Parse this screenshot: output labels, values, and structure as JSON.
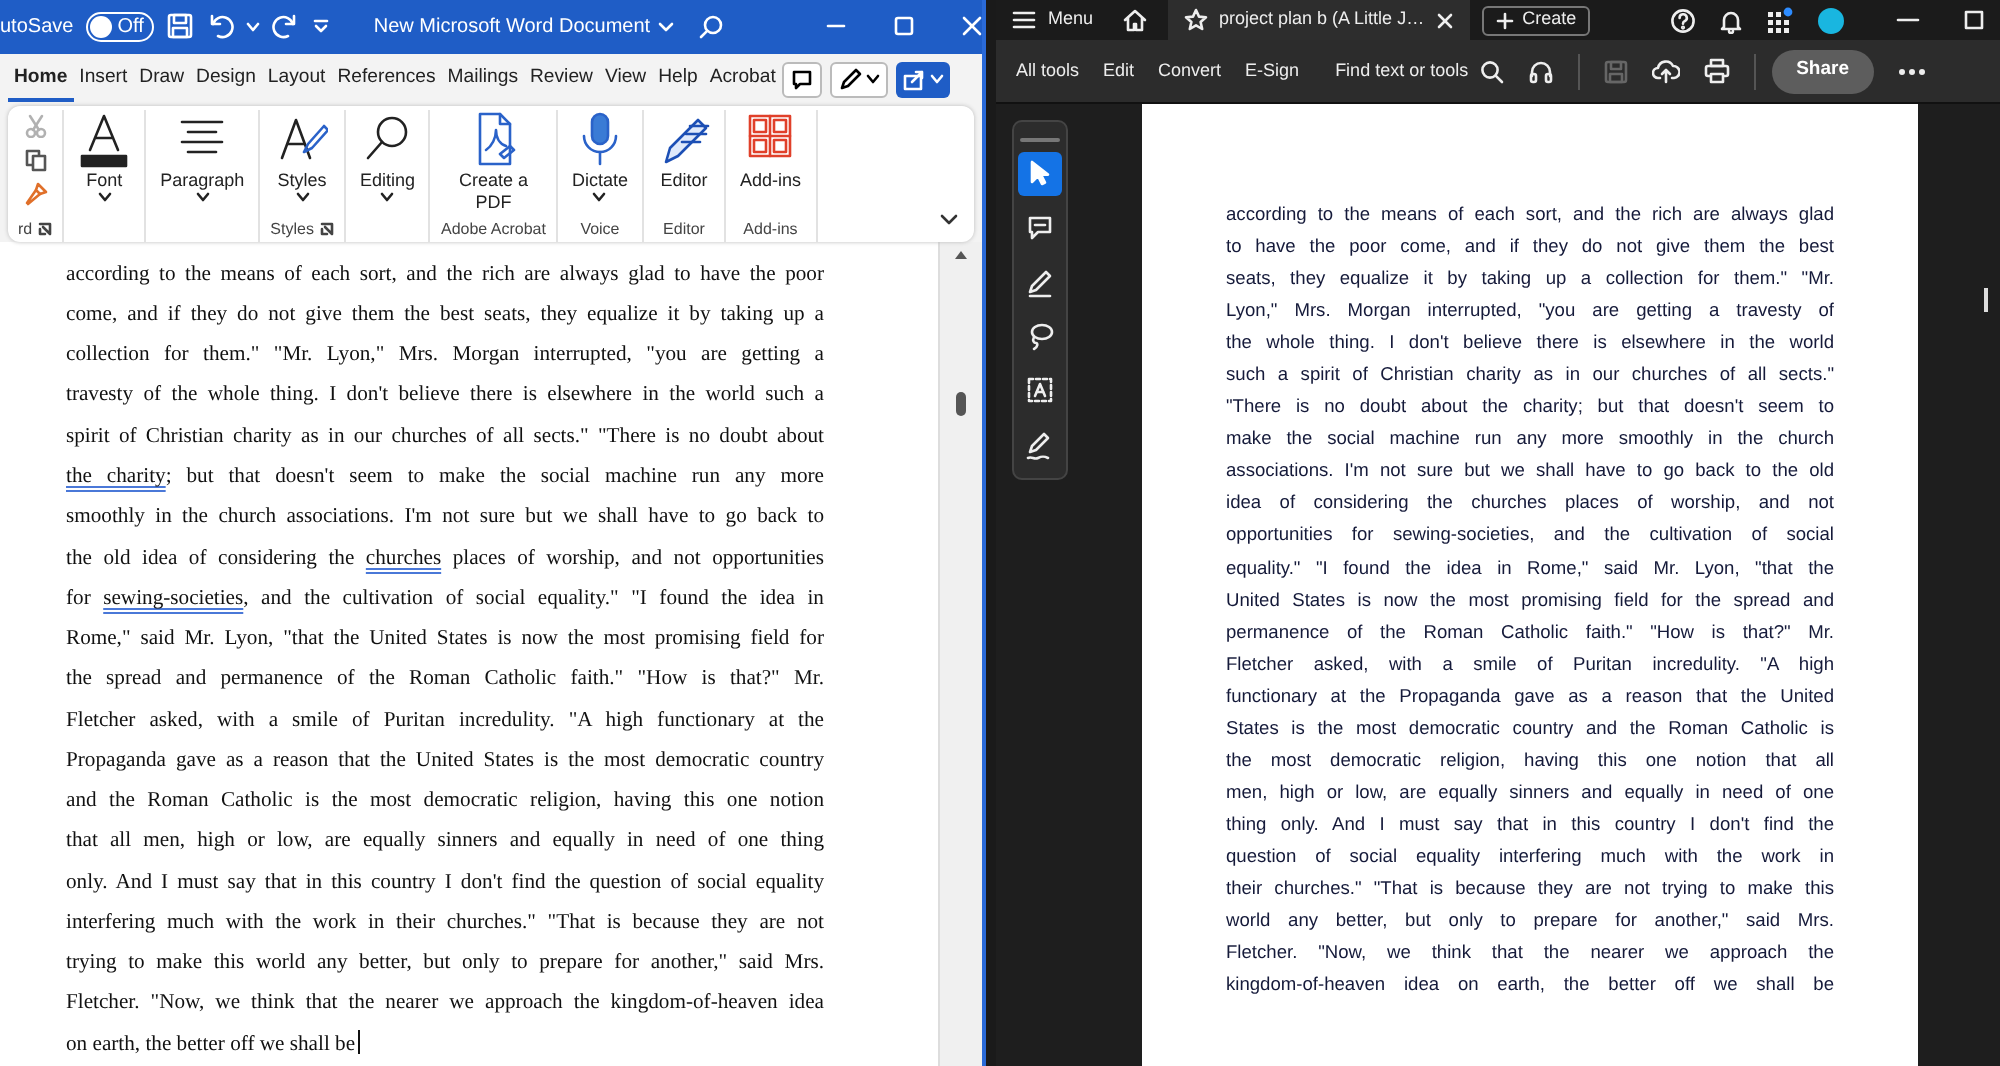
{
  "word": {
    "title_bar": {
      "autosave_label": "utoSave",
      "autosave": {
        "on": false,
        "label": "Off"
      },
      "document_title": "New Microsoft Word Document"
    },
    "tabs": [
      {
        "label": "Home",
        "selected": true
      },
      {
        "label": "Insert",
        "selected": false
      },
      {
        "label": "Draw",
        "selected": false
      },
      {
        "label": "Design",
        "selected": false
      },
      {
        "label": "Layout",
        "selected": false
      },
      {
        "label": "References",
        "selected": false
      },
      {
        "label": "Mailings",
        "selected": false
      },
      {
        "label": "Review",
        "selected": false
      },
      {
        "label": "View",
        "selected": false
      },
      {
        "label": "Help",
        "selected": false
      },
      {
        "label": "Acrobat",
        "selected": false
      }
    ],
    "ribbon_groups": [
      {
        "label": "rd",
        "launcher": true,
        "commands": [
          {
            "kind": "cut",
            "disabled": true
          },
          {
            "kind": "copy",
            "disabled": false
          },
          {
            "kind": "format-painter",
            "disabled": false
          }
        ]
      },
      {
        "commands": [
          {
            "kind": "font",
            "label": "Font",
            "dropdown": true
          }
        ]
      },
      {
        "commands": [
          {
            "kind": "paragraph",
            "label": "Paragraph",
            "dropdown": true
          }
        ]
      },
      {
        "label": "Styles",
        "launcher": true,
        "commands": [
          {
            "kind": "styles",
            "label": "Styles",
            "dropdown": true
          }
        ]
      },
      {
        "commands": [
          {
            "kind": "editing",
            "label": "Editing",
            "dropdown": true
          }
        ]
      },
      {
        "label": "Adobe Acrobat",
        "launcher": false,
        "commands": [
          {
            "kind": "pdf",
            "label": "Create a PDF",
            "dropdown": false
          }
        ]
      },
      {
        "label": "Voice",
        "launcher": false,
        "commands": [
          {
            "kind": "dictate",
            "label": "Dictate",
            "dropdown": true
          }
        ]
      },
      {
        "label": "Editor",
        "launcher": false,
        "commands": [
          {
            "kind": "editor",
            "label": "Editor",
            "dropdown": false
          }
        ]
      },
      {
        "label": "Add-ins",
        "launcher": false,
        "commands": [
          {
            "kind": "addins",
            "label": "Add-ins",
            "dropdown": false
          }
        ]
      }
    ],
    "document": {
      "lines": [
        "according to the means of each sort, and the rich are always glad to have the poor",
        "come, and if they do not give them the best seats, they equalize it by taking up a",
        "collection for them.\" \"Mr. Lyon,\" Mrs. Morgan interrupted, \"you are getting a",
        "travesty of the whole thing. I don't believe there is elsewhere in the world such a",
        "spirit of Christian charity as in our churches of all sects.\" \"There is no doubt about",
        [
          {
            "text": "the charity",
            "flagged": true
          },
          {
            "text": "; but that doesn't seem to make the social machine run any more",
            "flagged": false
          }
        ],
        "smoothly in the church associations. I'm not sure but we shall have to go back to",
        [
          {
            "text": "the old idea of considering the ",
            "flagged": false
          },
          {
            "text": "churches",
            "flagged": true
          },
          {
            "text": " places of worship, and not opportunities",
            "flagged": false
          }
        ],
        [
          {
            "text": "for ",
            "flagged": false
          },
          {
            "text": "sewing-societies",
            "flagged": true
          },
          {
            "text": ", and the cultivation of social equality.\" \"I found the idea in",
            "flagged": false
          }
        ],
        "Rome,\" said Mr. Lyon, \"that the United States is now the most promising field for",
        "the spread and permanence of the Roman Catholic faith.\" \"How is that?\" Mr.",
        "Fletcher asked, with a smile of Puritan incredulity. \"A high functionary at the",
        "Propaganda gave as a reason that the United States is the most democratic country",
        "and the Roman Catholic is the most democratic religion, having this one notion",
        "that all men, high or low, are equally sinners and equally in need of one thing",
        "only. And I must say that in this country I don't find the question of social equality",
        "interfering much with the work in their churches.\" \"That is because they are not",
        "trying to make this world any better, but only to prepare for another,\" said Mrs.",
        "Fletcher. \"Now, we think that the nearer we approach the kingdom-of-heaven idea",
        "on earth, the better off we shall be"
      ]
    }
  },
  "acrobat": {
    "top_bar": {
      "menu_label": "Menu",
      "tab_title": "project plan b (A Little J…",
      "create_label": "Create"
    },
    "toolbar": {
      "items": [
        "All tools",
        "Edit",
        "Convert",
        "E-Sign"
      ],
      "search_label": "Find text or tools",
      "save_disabled": true,
      "share_label": "Share"
    },
    "tools": [
      {
        "kind": "select",
        "selected": true
      },
      {
        "kind": "comment",
        "selected": false
      },
      {
        "kind": "draw",
        "selected": false
      },
      {
        "kind": "lasso",
        "selected": false
      },
      {
        "kind": "text-select",
        "selected": false
      },
      {
        "kind": "sign",
        "selected": false
      }
    ],
    "page": {
      "lines": [
        "according to the means of each sort, and the rich are always glad",
        "to have the poor come, and if they do not give them the best",
        "seats, they equalize it by taking up a collection for them.\" \"Mr.",
        "Lyon,\" Mrs. Morgan interrupted, \"you are getting a travesty of",
        "the whole thing. I don't believe there is elsewhere in the world",
        "such a spirit of Christian charity as in our churches of all sects.\"",
        "\"There is no doubt about the charity; but that doesn't seem to",
        "make the social machine run any more smoothly in the church",
        "associations. I'm not sure but we shall have to go back to the old",
        "idea of considering the churches places of worship, and not",
        "opportunities for sewing-societies, and the cultivation of social",
        "equality.\" \"I found the idea in Rome,\" said Mr. Lyon, \"that the",
        "United States is now the most promising field for the spread and",
        "permanence of the Roman Catholic faith.\" \"How is that?\" Mr.",
        "Fletcher asked, with a smile of Puritan incredulity. \"A high",
        "functionary at the Propaganda gave as a reason that the United",
        "States is the most democratic country and the Roman Catholic is",
        "the most democratic religion, having this one notion that all",
        "men, high or low, are equally sinners and equally in need of one",
        "thing only. And I must say that in this country I don't find the",
        "question of social equality interfering much with the work in",
        "their churches.\" \"That is because they are not trying to make this",
        "world any better, but only to prepare for another,\" said Mrs.",
        "Fletcher. \"Now, we think that the nearer we approach the",
        "kingdom-of-heaven idea on earth, the better off we shall be"
      ]
    }
  }
}
